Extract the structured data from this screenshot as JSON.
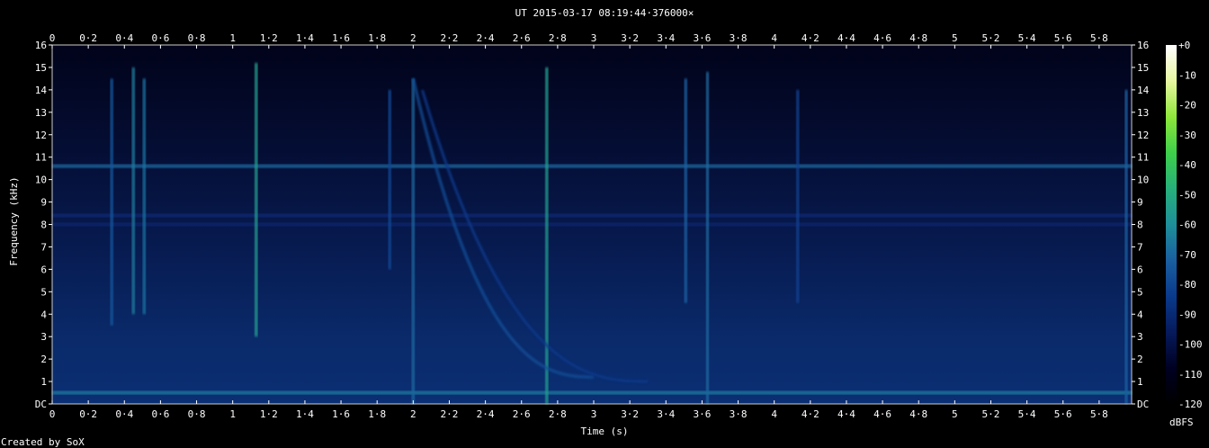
{
  "chart_data": {
    "type": "heatmap",
    "title": "UT 2015-03-17 08:19:44·376000×",
    "xlabel": "Time (s)",
    "ylabel": "Frequency (kHz)",
    "xlim": [
      0,
      5.98
    ],
    "ylim": [
      0,
      16
    ],
    "x_ticks": [
      "0",
      "0·2",
      "0·4",
      "0·6",
      "0·8",
      "1",
      "1·2",
      "1·4",
      "1·6",
      "1·8",
      "2",
      "2·2",
      "2·4",
      "2·6",
      "2·8",
      "3",
      "3·2",
      "3·4",
      "3·6",
      "3·8",
      "4",
      "4·2",
      "4·4",
      "4·6",
      "4·8",
      "5",
      "5·2",
      "5·4",
      "5·6",
      "5·8"
    ],
    "y_ticks": [
      "DC",
      "1",
      "2",
      "3",
      "4",
      "5",
      "6",
      "7",
      "8",
      "9",
      "10",
      "11",
      "12",
      "13",
      "14",
      "15",
      "16"
    ],
    "colorbar": {
      "label": "dBFS",
      "min": -120,
      "max": 0,
      "ticks": [
        "+0",
        "-10",
        "-20",
        "-30",
        "-40",
        "-50",
        "-60",
        "-70",
        "-80",
        "-90",
        "-100",
        "-110",
        "-120"
      ],
      "colors": [
        "#000000",
        "#000022",
        "#061a5c",
        "#0a3a8c",
        "#1a5fa0",
        "#1e8f9a",
        "#27b07a",
        "#3ed04a",
        "#8ee83a",
        "#e8f7a0",
        "#ffffff"
      ]
    },
    "background_level_dbfs": -105,
    "features": [
      {
        "kind": "tone",
        "freq_khz": 10.6,
        "level_dbfs": -70
      },
      {
        "kind": "tone",
        "freq_khz": 8.4,
        "level_dbfs": -90
      },
      {
        "kind": "tone",
        "freq_khz": 8.0,
        "level_dbfs": -92
      },
      {
        "kind": "tone",
        "freq_khz": 0.5,
        "level_dbfs": -65
      },
      {
        "kind": "sferic",
        "t": 0.33,
        "fmin": 3.5,
        "fmax": 14.5,
        "level_dbfs": -75
      },
      {
        "kind": "sferic",
        "t": 0.45,
        "fmin": 4.0,
        "fmax": 15.0,
        "level_dbfs": -65
      },
      {
        "kind": "sferic",
        "t": 0.51,
        "fmin": 4.0,
        "fmax": 14.5,
        "level_dbfs": -68
      },
      {
        "kind": "sferic",
        "t": 1.13,
        "fmin": 3.0,
        "fmax": 15.2,
        "level_dbfs": -55
      },
      {
        "kind": "sferic",
        "t": 1.87,
        "fmin": 6.0,
        "fmax": 14.0,
        "level_dbfs": -80
      },
      {
        "kind": "sferic",
        "t": 2.0,
        "fmin": 0.0,
        "fmax": 14.5,
        "level_dbfs": -70
      },
      {
        "kind": "sferic",
        "t": 2.74,
        "fmin": 0.0,
        "fmax": 15.0,
        "level_dbfs": -55
      },
      {
        "kind": "sferic",
        "t": 3.51,
        "fmin": 4.5,
        "fmax": 14.5,
        "level_dbfs": -72
      },
      {
        "kind": "sferic",
        "t": 3.63,
        "fmin": 0.0,
        "fmax": 14.8,
        "level_dbfs": -70
      },
      {
        "kind": "sferic",
        "t": 4.13,
        "fmin": 4.5,
        "fmax": 14.0,
        "level_dbfs": -82
      },
      {
        "kind": "sferic",
        "t": 5.95,
        "fmin": 0.0,
        "fmax": 14.0,
        "level_dbfs": -72
      },
      {
        "kind": "whistler",
        "t0": 2.0,
        "fmax": 14.5,
        "tend": 3.0,
        "fend": 1.2,
        "level_dbfs": -78
      },
      {
        "kind": "whistler",
        "t0": 2.05,
        "fmax": 14.0,
        "tend": 3.3,
        "fend": 1.0,
        "level_dbfs": -85
      }
    ]
  },
  "footer": {
    "credit": "Created by SoX"
  }
}
